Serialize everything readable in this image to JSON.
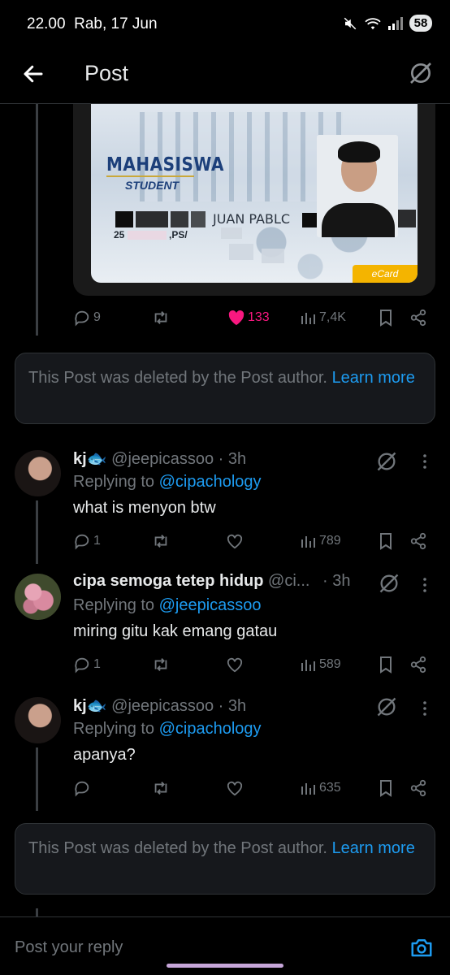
{
  "status_bar": {
    "time": "22.00",
    "date": "Rab, 17 Jun",
    "battery": "58"
  },
  "header": {
    "title": "Post"
  },
  "media": {
    "card_label_1": "MAHASISWA",
    "card_label_2": "STUDENT",
    "card_name": "JUAN PABLC",
    "card_number_start": "25",
    "card_number_mid": ",PS/",
    "card_badge": "eCard"
  },
  "main_post": {
    "replies": "9",
    "likes": "133",
    "views": "7,4K"
  },
  "deleted_notice": {
    "text": "This Post was deleted by the Post author.",
    "link": "Learn more"
  },
  "replies": [
    {
      "name": "kj",
      "handle": "@jeepicassoo",
      "time": "· 3h",
      "replying_label": "Replying to",
      "replying_to": "@cipachology",
      "text": "what is menyon btw",
      "reply_count": "1",
      "views": "789"
    },
    {
      "name": "cipa semoga tetep hidup",
      "handle": "@ci...",
      "time": "· 3h",
      "replying_label": "Replying to",
      "replying_to": "@jeepicassoo",
      "text": "miring gitu kak emang gatau",
      "reply_count": "1",
      "views": "589"
    },
    {
      "name": "kj",
      "handle": "@jeepicassoo",
      "time": "· 3h",
      "replying_label": "Replying to",
      "replying_to": "@cipachology",
      "text": "apanya?",
      "reply_count": "",
      "views": "635"
    }
  ],
  "deleted_notice_2": {
    "text": "This Post was deleted by the Post author.",
    "link": "Learn more"
  },
  "compose": {
    "placeholder": "Post your reply"
  },
  "colors": {
    "accent": "#1d9bf0",
    "like": "#f91880",
    "muted": "#71767b",
    "background": "#000000"
  }
}
